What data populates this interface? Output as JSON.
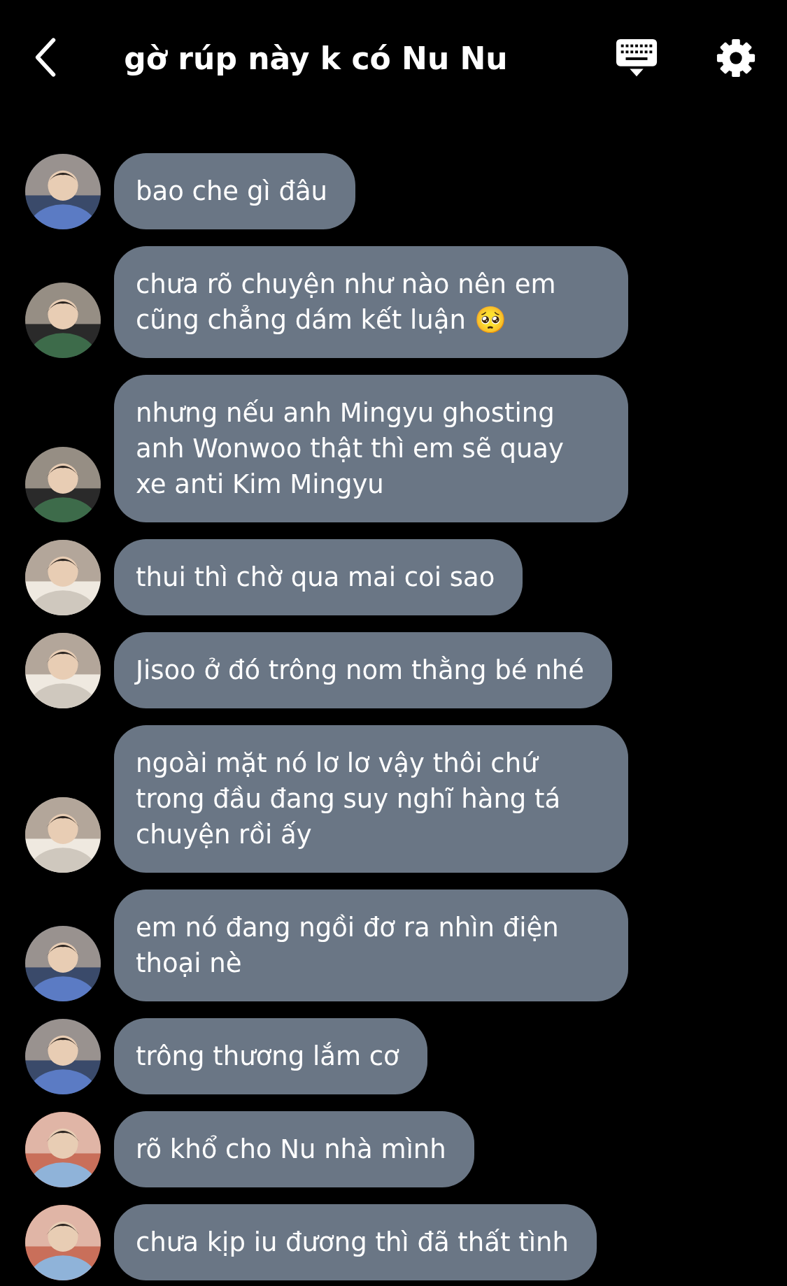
{
  "header": {
    "title": "gờ rúp này k có Nu Nu"
  },
  "messages": [
    {
      "text": "bao che gì đâu"
    },
    {
      "text": "chưa rõ chuyện như nào nên em cũng chẳng dám kết luận 🥺"
    },
    {
      "text": "nhưng nếu anh Mingyu ghosting anh Wonwoo thật thì em sẽ quay xe anti Kim Mingyu"
    },
    {
      "text": "thui thì chờ qua mai coi sao"
    },
    {
      "text": "Jisoo ở đó trông nom thằng bé nhé"
    },
    {
      "text": "ngoài mặt nó lơ lơ vậy thôi chứ trong đầu đang suy nghĩ hàng tá chuyện rồi ấy"
    },
    {
      "text": "em nó đang ngồi đơ ra nhìn điện thoại nè"
    },
    {
      "text": "trông thương lắm cơ"
    },
    {
      "text": "rõ khổ cho Nu nhà mình"
    },
    {
      "text": "chưa kịp iu đương thì đã thất tình"
    }
  ]
}
